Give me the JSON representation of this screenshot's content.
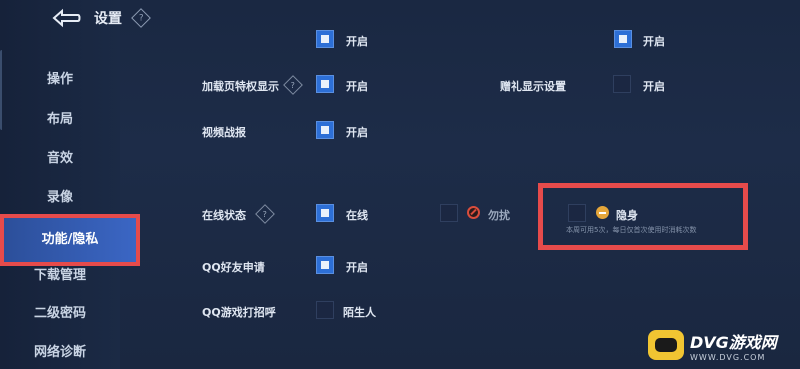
{
  "header": {
    "title": "设置"
  },
  "sidebar": {
    "items": [
      {
        "label": "操作"
      },
      {
        "label": "布局"
      },
      {
        "label": "音效"
      },
      {
        "label": "录像"
      },
      {
        "label": "功能/隐私"
      },
      {
        "label": "下载管理"
      },
      {
        "label": "二级密码"
      },
      {
        "label": "网络诊断"
      }
    ],
    "active_index": 4
  },
  "settings": {
    "row0": {
      "label_left": "开启",
      "label_right": "开启"
    },
    "loading_privilege": {
      "label": "加载页特权显示",
      "value": "开启"
    },
    "gift_display": {
      "label": "赠礼显示设置",
      "value": "开启"
    },
    "video_report": {
      "label": "视频战报",
      "value": "开启"
    },
    "online_status": {
      "label": "在线状态",
      "options": [
        {
          "name": "online",
          "label": "在线",
          "checked": true
        },
        {
          "name": "dnd",
          "label": "勿扰",
          "checked": false
        },
        {
          "name": "invisible",
          "label": "隐身",
          "checked": false
        }
      ],
      "invisible_note": "本周可用5次，每日仅首次使用时消耗次数"
    },
    "qq_friend_request": {
      "label": "QQ好友申请",
      "value": "开启"
    },
    "qq_game_greeting": {
      "label": "QQ游戏打招呼",
      "value": "陌生人"
    }
  },
  "watermark": {
    "title": "DVG游戏网",
    "url": "WWW.DVG.COM"
  },
  "colors": {
    "accent": "#2d6fd6",
    "highlight": "#e64b4b",
    "active_tab": "#3b66c4"
  }
}
